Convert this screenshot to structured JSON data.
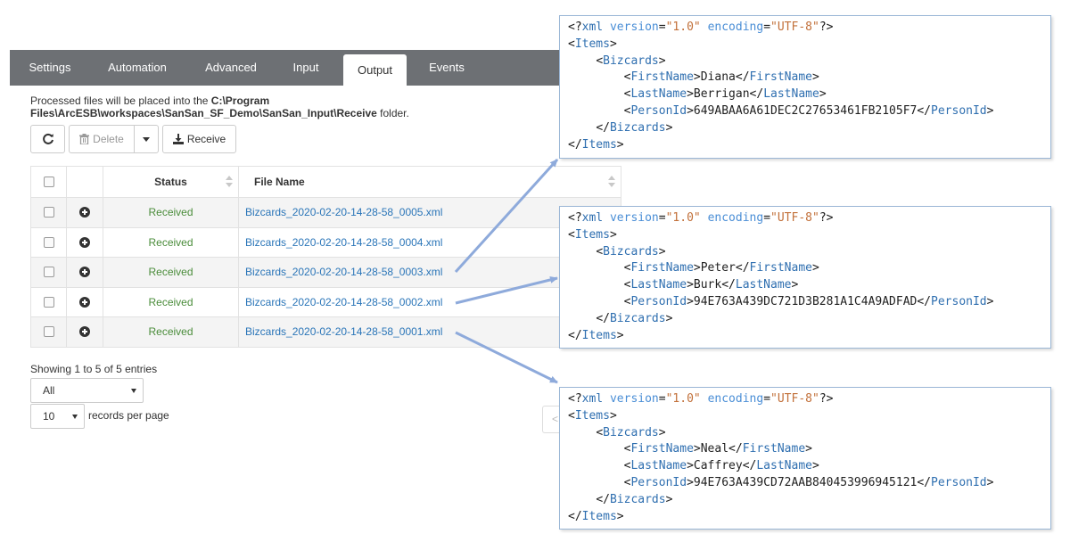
{
  "tabs": [
    {
      "label": "Settings",
      "active": false
    },
    {
      "label": "Automation",
      "active": false
    },
    {
      "label": "Advanced",
      "active": false
    },
    {
      "label": "Input",
      "active": false
    },
    {
      "label": "Output",
      "active": true
    },
    {
      "label": "Events",
      "active": false
    }
  ],
  "info": {
    "prefix": "Processed files will be placed into the ",
    "path": "C:\\Program Files\\ArcESB\\workspaces\\SanSan_SF_Demo\\SanSan_Input\\Receive",
    "suffix": " folder."
  },
  "toolbar": {
    "refresh_icon": "refresh-icon",
    "delete_label": "Delete",
    "delete_icon": "trash-icon",
    "receive_label": "Receive",
    "receive_icon": "download-icon"
  },
  "table": {
    "columns": {
      "status": "Status",
      "file_name": "File Name"
    },
    "rows": [
      {
        "status": "Received",
        "file": "Bizcards_2020-02-20-14-28-58_0005.xml"
      },
      {
        "status": "Received",
        "file": "Bizcards_2020-02-20-14-28-58_0004.xml"
      },
      {
        "status": "Received",
        "file": "Bizcards_2020-02-20-14-28-58_0003.xml"
      },
      {
        "status": "Received",
        "file": "Bizcards_2020-02-20-14-28-58_0002.xml"
      },
      {
        "status": "Received",
        "file": "Bizcards_2020-02-20-14-28-58_0001.xml"
      }
    ]
  },
  "footer": {
    "showing": "Showing 1 to 5 of 5 entries",
    "filter_value": "All",
    "page_size_value": "10",
    "page_size_label": "records per page",
    "pager_prev": "<"
  },
  "xml_common": {
    "decl_open": "<?",
    "decl_name": "xml",
    "attr_version": "version",
    "val_version": "\"1.0\"",
    "attr_encoding": "encoding",
    "val_encoding": "\"UTF-8\"",
    "decl_close": "?>",
    "items_tag": "Items",
    "bizcards_tag": "Bizcards",
    "first_tag": "FirstName",
    "last_tag": "LastName",
    "person_tag": "PersonId"
  },
  "xml_docs": [
    {
      "first": "Diana",
      "last": "Berrigan",
      "person": "649ABAA6A61DEC2C27653461FB2105F7"
    },
    {
      "first": "Peter",
      "last": "Burk",
      "person": "94E763A439DC721D3B281A1C4A9ADFAD"
    },
    {
      "first": "Neal",
      "last": "Caffrey",
      "person": "94E763A439CD72AAB840453996945121"
    }
  ],
  "colors": {
    "tabbar": "#6d7074",
    "link": "#2a75b8",
    "status": "#4a8c3a",
    "xml_tag": "#2f6fb0",
    "xml_attr": "#4a8ed6",
    "xml_value": "#c2703a",
    "arrow": "#8eaadb"
  }
}
